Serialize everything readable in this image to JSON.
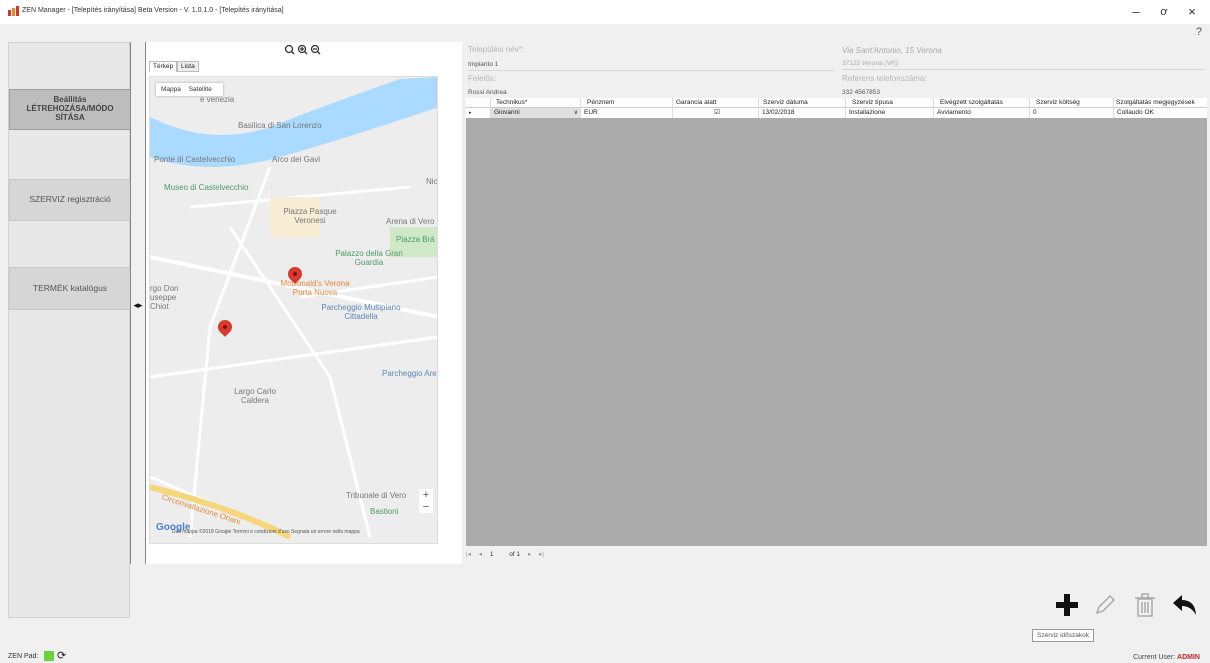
{
  "window": {
    "title": "ZEN Manager - [Telepítés irányítása] Beta Version - V. 1.0.1.0 - [Telepítés irányítása]",
    "minimize": "–",
    "maximize": "ơ",
    "close": "×",
    "help": "?"
  },
  "sidebar": {
    "items": [
      {
        "label": "Beállítás LÉTREHOZÁSA/MÓDOSÍTÁSA",
        "line1": "Beállítás",
        "line2": "LÉTREHOZÁSA/MÓDO",
        "line3": "SÍTÁSA"
      },
      {
        "label": "SZERVIZ regisztráció"
      },
      {
        "label": "TERMÉK katalógus"
      }
    ],
    "splitter_icon": "◂▸"
  },
  "map_panel": {
    "zoom_icons": "🔍︎⊕⊖",
    "tabs": [
      "Térkép",
      "Lista"
    ],
    "map_type": [
      "Mappa",
      "Satellite"
    ],
    "labels": [
      "Basilica di San Lorenzo",
      "Ponte di Castelvecchio",
      "Arco dei Gavi",
      "Museo di Castelvecchio",
      "Piazza Pasque Veronesi",
      "Arena di Vero",
      "Piazza Brà",
      "Palazzo della Gran Guardia",
      "McDonald's Verona Porta Nuova",
      "Parcheggio Multipiano Cittadella",
      "Parcheggio Are",
      "Largo Carlo Caldera",
      "Tribunale di Vero",
      "Bastioni",
      "Circonvallazione Oriani",
      "rgo Don useppe Chiot",
      "e venezia",
      "Nic"
    ],
    "google": "Google",
    "footer": "Dati mappa ©2018 Google   Termini e condizioni d'uso   Segnala un errore nella mappa"
  },
  "form": {
    "site_name_label": "Települési név*:",
    "site_name_value": "Impianto 1",
    "address_line1": "Via Sant'Antonio, 15 Verona",
    "address_line2": "37122 Verona (VR)",
    "responsible_label": "Felelős:",
    "responsible_value": "Rossi Andrea",
    "ref_phone_label": "Referens telefonszáma:",
    "ref_phone_value": "332 4567853"
  },
  "grid": {
    "columns": [
      "Technikus*",
      "Pénznem",
      "Garancia alatt",
      "Szerviz dátuma",
      "Szerviz típusa",
      "Elvégzett szolgáltatás",
      "Szerviz költség",
      "Szolgáltatás megjegyzések"
    ],
    "rows": [
      {
        "technician": "Giovanni",
        "currency": "EUR",
        "warranty": "☑",
        "date": "13/02/2018",
        "type": "Installazione",
        "service": "Avviamento",
        "cost": "0",
        "notes": "Collaudo OK"
      }
    ]
  },
  "pager": {
    "first": "|◂",
    "prev": "◂",
    "page": "1",
    "of": "of 1",
    "next": "▸",
    "last": "▸|"
  },
  "actions": {
    "tooltip": "Szerviz időszakok"
  },
  "status": {
    "zen_pad_label": "ZEN Pad:",
    "current_user_label": "Current User:",
    "current_user": "ADMIN"
  },
  "colors": {
    "accent": "#c3272b",
    "zen_pad_ok": "#6ad33b"
  }
}
